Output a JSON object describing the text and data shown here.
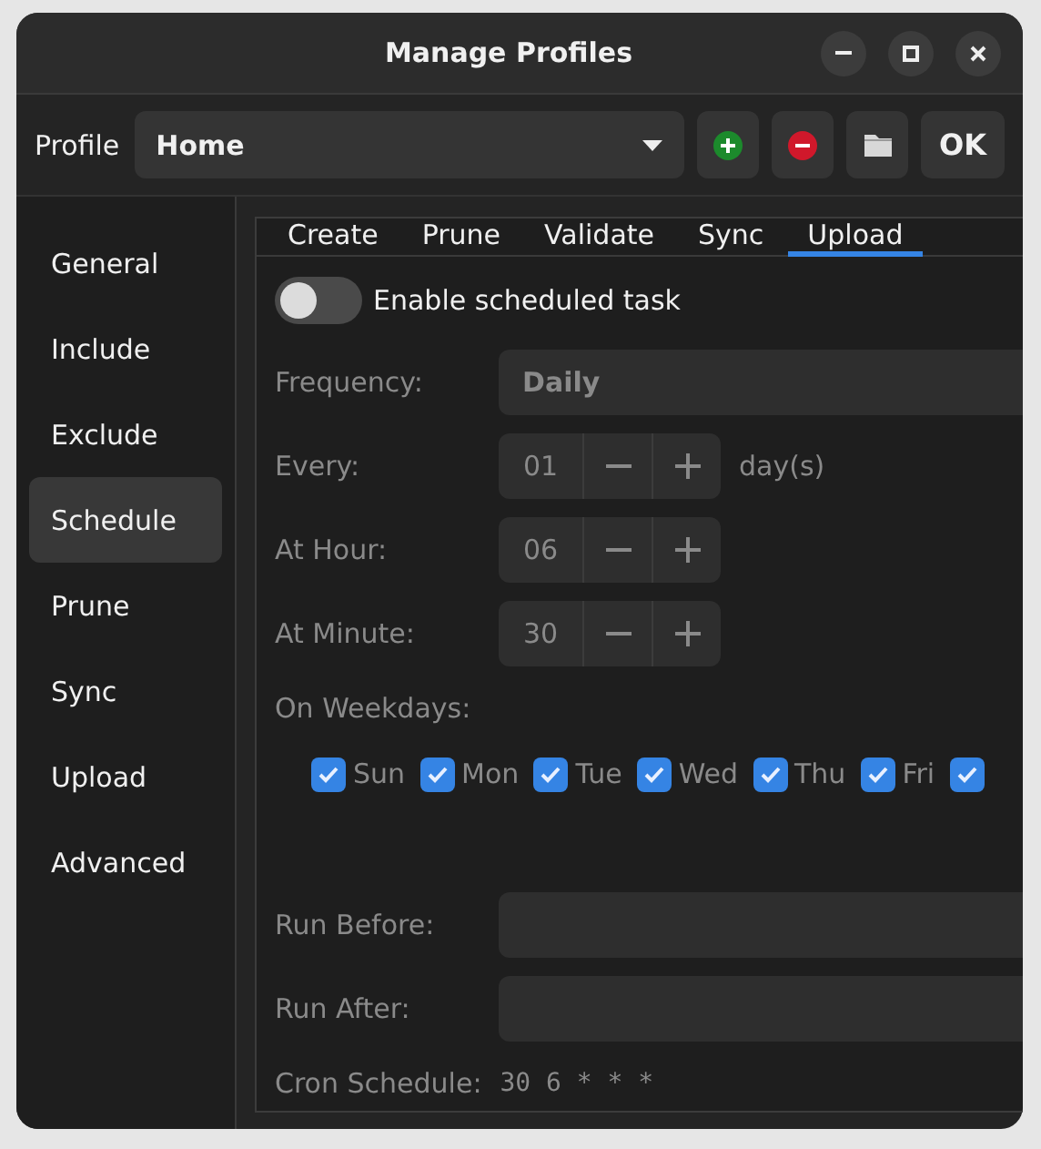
{
  "window": {
    "title": "Manage Profiles"
  },
  "profile": {
    "label": "Profile",
    "value": "Home",
    "ok": "OK"
  },
  "sidebar": {
    "items": [
      {
        "label": "General",
        "selected": false
      },
      {
        "label": "Include",
        "selected": false
      },
      {
        "label": "Exclude",
        "selected": false
      },
      {
        "label": "Schedule",
        "selected": true
      },
      {
        "label": "Prune",
        "selected": false
      },
      {
        "label": "Sync",
        "selected": false
      },
      {
        "label": "Upload",
        "selected": false
      },
      {
        "label": "Advanced",
        "selected": false
      }
    ]
  },
  "tabs": [
    {
      "label": "Create",
      "selected": false
    },
    {
      "label": "Prune",
      "selected": false
    },
    {
      "label": "Validate",
      "selected": false
    },
    {
      "label": "Sync",
      "selected": false
    },
    {
      "label": "Upload",
      "selected": true
    }
  ],
  "schedule": {
    "enable": {
      "label": "Enable scheduled task",
      "on": false
    },
    "disabled": true,
    "frequency": {
      "label": "Frequency:",
      "value": "Daily"
    },
    "spinners": [
      {
        "label": "Every:",
        "value": "01",
        "unit": "day(s)"
      },
      {
        "label": "At Hour:",
        "value": "06"
      },
      {
        "label": "At Minute:",
        "value": "30"
      }
    ],
    "weekdays_label": "On Weekdays:",
    "weekdays": [
      {
        "label": "Sun",
        "checked": true
      },
      {
        "label": "Mon",
        "checked": true
      },
      {
        "label": "Tue",
        "checked": true
      },
      {
        "label": "Wed",
        "checked": true
      },
      {
        "label": "Thu",
        "checked": true
      },
      {
        "label": "Fri",
        "checked": true
      },
      {
        "checked": true
      }
    ],
    "run_before": {
      "label": "Run Before:"
    },
    "run_after": {
      "label": "Run After:"
    },
    "cron": {
      "label": "Cron Schedule:",
      "value": "30 6 * * *"
    }
  }
}
